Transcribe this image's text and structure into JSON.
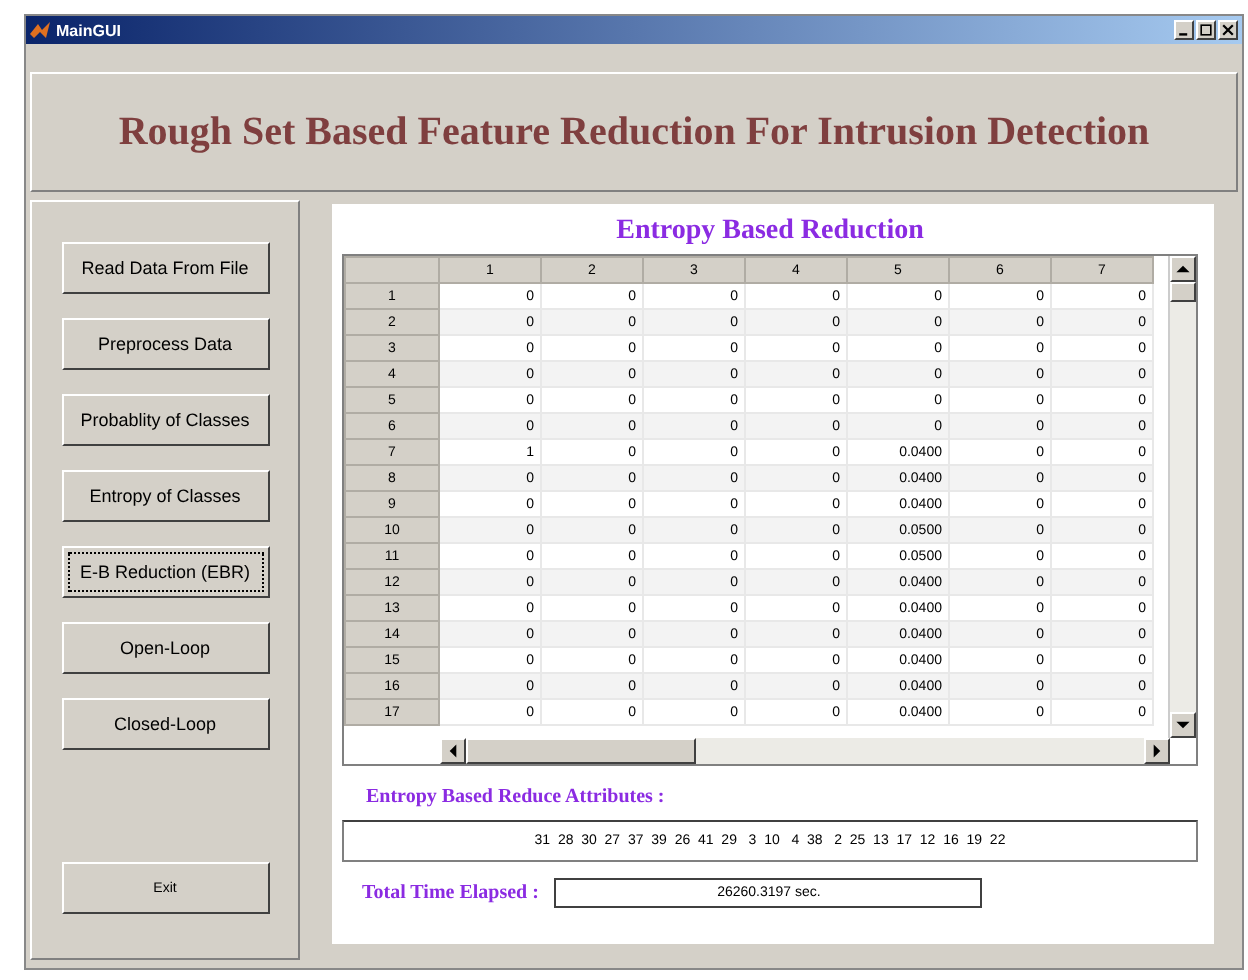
{
  "window": {
    "title": "MainGUI"
  },
  "header": {
    "title": "Rough Set Based Feature Reduction For Intrusion Detection"
  },
  "sidebar": {
    "buttons": [
      {
        "label": "Read Data From File",
        "focused": false
      },
      {
        "label": "Preprocess Data",
        "focused": false
      },
      {
        "label": "Probablity of Classes",
        "focused": false
      },
      {
        "label": "Entropy of Classes",
        "focused": false
      },
      {
        "label": "E-B Reduction (EBR)",
        "focused": true
      },
      {
        "label": "Open-Loop",
        "focused": false
      },
      {
        "label": "Closed-Loop",
        "focused": false
      }
    ],
    "exit_button": {
      "label": "Exit",
      "focused": false
    }
  },
  "panel": {
    "title": "Entropy Based Reduction",
    "table": {
      "columns": [
        "1",
        "2",
        "3",
        "4",
        "5",
        "6",
        "7"
      ],
      "rows": [
        {
          "label": "1",
          "cells": [
            "0",
            "0",
            "0",
            "0",
            "0",
            "0",
            "0"
          ]
        },
        {
          "label": "2",
          "cells": [
            "0",
            "0",
            "0",
            "0",
            "0",
            "0",
            "0"
          ]
        },
        {
          "label": "3",
          "cells": [
            "0",
            "0",
            "0",
            "0",
            "0",
            "0",
            "0"
          ]
        },
        {
          "label": "4",
          "cells": [
            "0",
            "0",
            "0",
            "0",
            "0",
            "0",
            "0"
          ]
        },
        {
          "label": "5",
          "cells": [
            "0",
            "0",
            "0",
            "0",
            "0",
            "0",
            "0"
          ]
        },
        {
          "label": "6",
          "cells": [
            "0",
            "0",
            "0",
            "0",
            "0",
            "0",
            "0"
          ]
        },
        {
          "label": "7",
          "cells": [
            "1",
            "0",
            "0",
            "0",
            "0.0400",
            "0",
            "0"
          ]
        },
        {
          "label": "8",
          "cells": [
            "0",
            "0",
            "0",
            "0",
            "0.0400",
            "0",
            "0"
          ]
        },
        {
          "label": "9",
          "cells": [
            "0",
            "0",
            "0",
            "0",
            "0.0400",
            "0",
            "0"
          ]
        },
        {
          "label": "10",
          "cells": [
            "0",
            "0",
            "0",
            "0",
            "0.0500",
            "0",
            "0"
          ]
        },
        {
          "label": "11",
          "cells": [
            "0",
            "0",
            "0",
            "0",
            "0.0500",
            "0",
            "0"
          ]
        },
        {
          "label": "12",
          "cells": [
            "0",
            "0",
            "0",
            "0",
            "0.0400",
            "0",
            "0"
          ]
        },
        {
          "label": "13",
          "cells": [
            "0",
            "0",
            "0",
            "0",
            "0.0400",
            "0",
            "0"
          ]
        },
        {
          "label": "14",
          "cells": [
            "0",
            "0",
            "0",
            "0",
            "0.0400",
            "0",
            "0"
          ]
        },
        {
          "label": "15",
          "cells": [
            "0",
            "0",
            "0",
            "0",
            "0.0400",
            "0",
            "0"
          ]
        },
        {
          "label": "16",
          "cells": [
            "0",
            "0",
            "0",
            "0",
            "0.0400",
            "0",
            "0"
          ]
        },
        {
          "label": "17",
          "cells": [
            "0",
            "0",
            "0",
            "0",
            "0.0400",
            "0",
            "0"
          ]
        }
      ]
    },
    "attributes_label": "Entropy Based Reduce Attributes :",
    "attributes_value": "31  28  30  27  37  39  26  41  29   3  10   4  38   2  25  13  17  12  16  19  22",
    "time_label": "Total Time Elapsed :",
    "time_value": "26260.3197 sec."
  }
}
